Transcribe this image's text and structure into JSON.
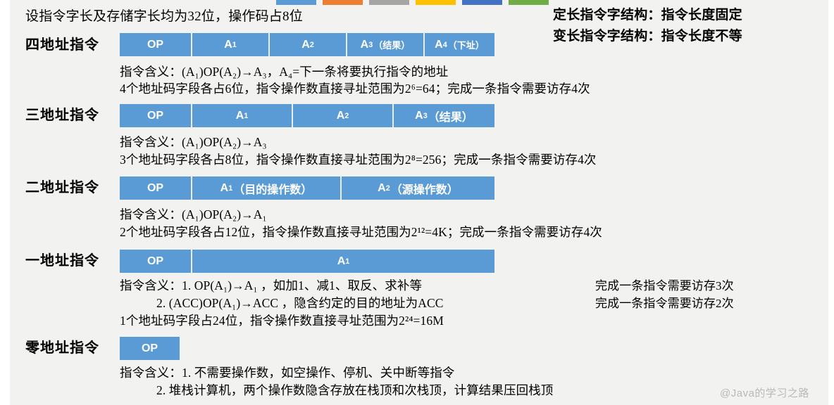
{
  "slide": {
    "header_note": "设指令字长及存储字长均为32位，操作码占8位",
    "right_notes": [
      "定长指令字结构：指令长度固定",
      "变长指令字结构：指令长度不等"
    ],
    "watermark": "@Java的学习之路",
    "swatch_colors": [
      "#5b9bd5",
      "#ed7d31",
      "#a5a5a5",
      "#ffc000",
      "#4472c4",
      "#70ad47"
    ],
    "bar_color": "#5b9bd5",
    "background": "#f2f2f1"
  },
  "rows": [
    {
      "label": "四地址指令",
      "cells": [
        {
          "main": "OP",
          "sub": "",
          "note": ""
        },
        {
          "main": "A",
          "sub": "1",
          "note": ""
        },
        {
          "main": "A",
          "sub": "2",
          "note": ""
        },
        {
          "main": "A",
          "sub": "3",
          "note": "（结果）"
        },
        {
          "main": "A",
          "sub": "4",
          "note": "（下址）"
        }
      ],
      "lines": [
        "指令含义：(A₁)OP(A₂)→A₃，A₄=下一条将要执行指令的地址",
        "4个地址码字段各占6位，指令操作数直接寻址范围为2⁶=64；完成一条指令需要访存4次"
      ]
    },
    {
      "label": "三地址指令",
      "cells": [
        {
          "main": "OP",
          "sub": "",
          "note": ""
        },
        {
          "main": "A",
          "sub": "1",
          "note": ""
        },
        {
          "main": "A",
          "sub": "2",
          "note": ""
        },
        {
          "main": "A",
          "sub": "3",
          "note": "（结果）"
        }
      ],
      "lines": [
        "指令含义：(A₁)OP(A₂)→A₃",
        "3个地址码字段各占8位，指令操作数直接寻址范围为2⁸=256；完成一条指令需要访存4次"
      ]
    },
    {
      "label": "二地址指令",
      "cells": [
        {
          "main": "OP",
          "sub": "",
          "note": ""
        },
        {
          "main": "A",
          "sub": "1",
          "note": "（目的操作数）"
        },
        {
          "main": "A",
          "sub": "2",
          "note": "（源操作数）"
        }
      ],
      "lines": [
        "指令含义：(A₁)OP(A₂)→A₁",
        "2个地址码字段各占12位，指令操作数直接寻址范围为2¹²=4K；完成一条指令需要访存4次"
      ]
    },
    {
      "label": "一地址指令",
      "cells": [
        {
          "main": "OP",
          "sub": "",
          "note": ""
        },
        {
          "main": "A",
          "sub": "1",
          "note": ""
        }
      ],
      "lines": [
        "指令含义：1. OP(A₁)→A₁ ，如加1、减1、取反、求补等",
        "2. (ACC)OP(A₁)→ACC ，隐含约定的目的地址为ACC",
        "1个地址码字段占24位，指令操作数直接寻址范围为2²⁴=16M"
      ],
      "side_notes": [
        "完成一条指令需要访存3次",
        "完成一条指令需要访存2次"
      ]
    },
    {
      "label": "零地址指令",
      "cells": [
        {
          "main": "OP",
          "sub": "",
          "note": ""
        }
      ],
      "lines": [
        "指令含义：1. 不需要操作数，如空操作、停机、关中断等指令",
        "2. 堆栈计算机，两个操作数隐含存放在栈顶和次栈顶，计算结果压回栈顶"
      ]
    }
  ]
}
